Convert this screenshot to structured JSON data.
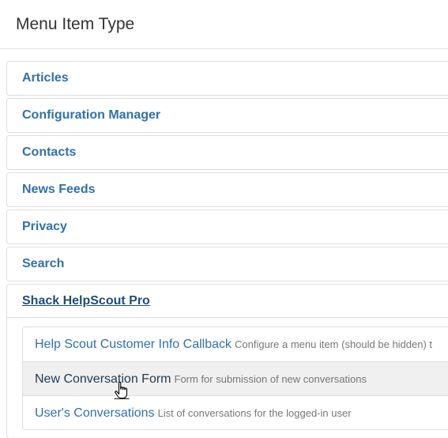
{
  "modal": {
    "title": "Menu Item Type"
  },
  "groups": [
    {
      "label": "Articles"
    },
    {
      "label": "Configuration Manager"
    },
    {
      "label": "Contacts"
    },
    {
      "label": "News Feeds"
    },
    {
      "label": "Privacy"
    },
    {
      "label": "Search"
    },
    {
      "label": "Shack HelpScout Pro",
      "items": [
        {
          "title": "Help Scout Customer Info Callback",
          "desc": "Configure a menu item (should be hidden) t"
        },
        {
          "title": "New Conversation Form",
          "desc": "Form for submission of new conversations"
        },
        {
          "title": "User's Conversations",
          "desc": "List of conversations for the logged-in user"
        }
      ]
    }
  ],
  "icons": {
    "cursor": "hand-pointer-icon"
  },
  "colors": {
    "link": "#3071a9",
    "link_active": "#1f4e79",
    "hover_bg": "#f0f0f0",
    "border": "#dddddd",
    "desc": "#777777"
  }
}
